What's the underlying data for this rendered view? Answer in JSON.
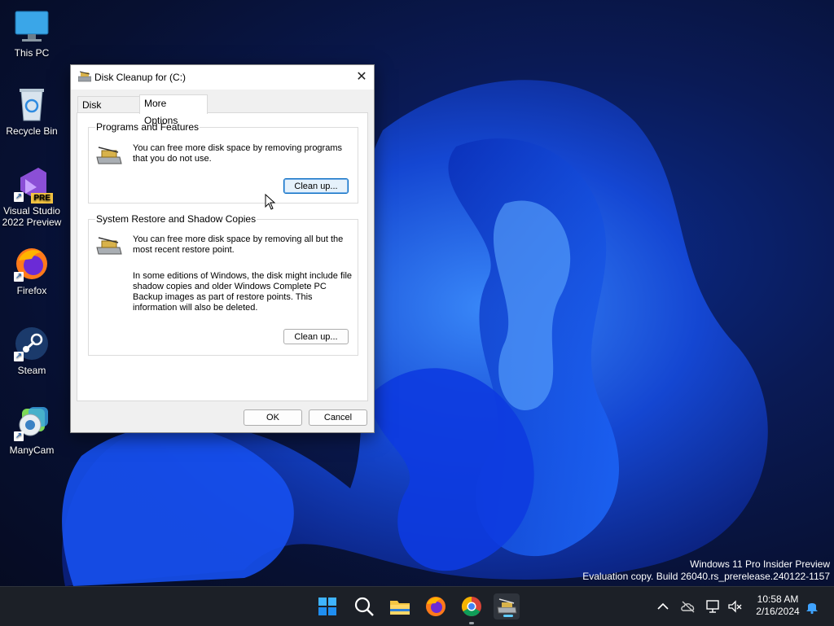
{
  "desktop": {
    "icons": [
      {
        "label": "This PC",
        "icon": "monitor-icon"
      },
      {
        "label": "Recycle Bin",
        "icon": "recycle-bin-icon"
      },
      {
        "label": "Visual Studio 2022 Preview",
        "badge": "PRE",
        "icon": "visual-studio-icon"
      },
      {
        "label": "Firefox",
        "icon": "firefox-icon"
      },
      {
        "label": "Steam",
        "icon": "steam-icon"
      },
      {
        "label": "ManyCam",
        "icon": "manycam-icon"
      }
    ]
  },
  "dialog": {
    "title": "Disk Cleanup for  (C:)",
    "close_glyph": "✕",
    "tabs": [
      {
        "label": "Disk Cleanup",
        "selected": false
      },
      {
        "label": "More Options",
        "selected": true
      }
    ],
    "programs_group": {
      "title": "Programs and Features",
      "text": "You can free more disk space by removing programs that you do not use.",
      "button": "Clean up..."
    },
    "restore_group": {
      "title": "System Restore and Shadow Copies",
      "text1": "You can free more disk space by removing all but the most recent restore point.",
      "text2": "In some editions of Windows, the disk might include file shadow copies and older Windows Complete PC Backup images as part of restore points. This information will also be deleted.",
      "button": "Clean up..."
    },
    "ok_label": "OK",
    "cancel_label": "Cancel"
  },
  "watermark": {
    "line1": "Windows 11 Pro Insider Preview",
    "line2": "Evaluation copy. Build 26040.rs_prerelease.240122-1157"
  },
  "taskbar": {
    "apps": [
      "start-icon",
      "search-icon",
      "file-explorer-icon",
      "firefox-icon",
      "chrome-icon",
      "disk-cleanup-icon"
    ],
    "time": "10:58 AM",
    "date": "2/16/2024"
  },
  "colors": {
    "accent": "#0067c0",
    "taskbar": "#1c2027"
  }
}
